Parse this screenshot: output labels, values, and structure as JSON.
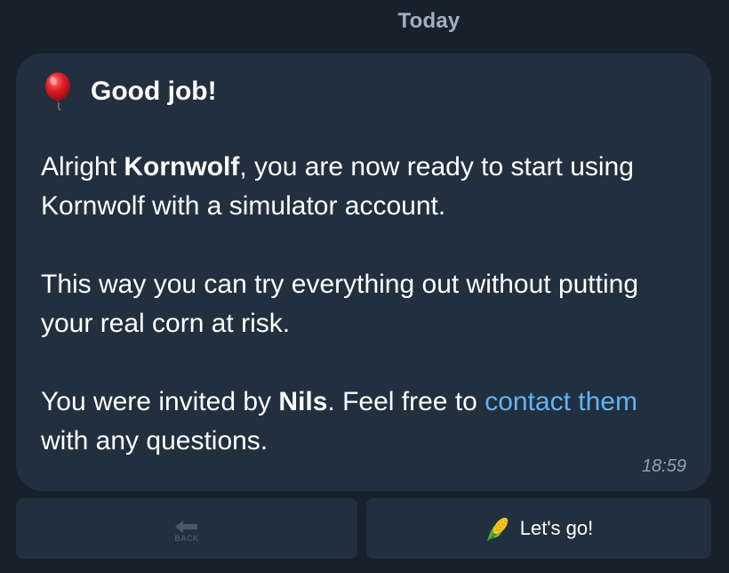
{
  "date_separator": "Today",
  "message": {
    "title_icon": "balloon-icon",
    "title": "Good job!",
    "p1": {
      "pre": "Alright ",
      "name": "Kornwolf",
      "post": ", you are now ready to start using Kornwolf with a simulator account."
    },
    "p2": "This way you can try everything out without putting your real corn at risk.",
    "p3": {
      "pre": "You were invited by ",
      "name": "Nils",
      "mid": ". Feel free to ",
      "link": "contact them",
      "post": " with any questions."
    },
    "time": "18:59"
  },
  "keyboard": {
    "back_label": "BACK",
    "back_icon": "back-arrow-icon",
    "go_icon": "corn-icon",
    "go_label": "Let's go!"
  },
  "colors": {
    "background": "#17212b",
    "bubble": "#222f3f",
    "link": "#62b3f0",
    "date_text": "#9fb0c2"
  }
}
